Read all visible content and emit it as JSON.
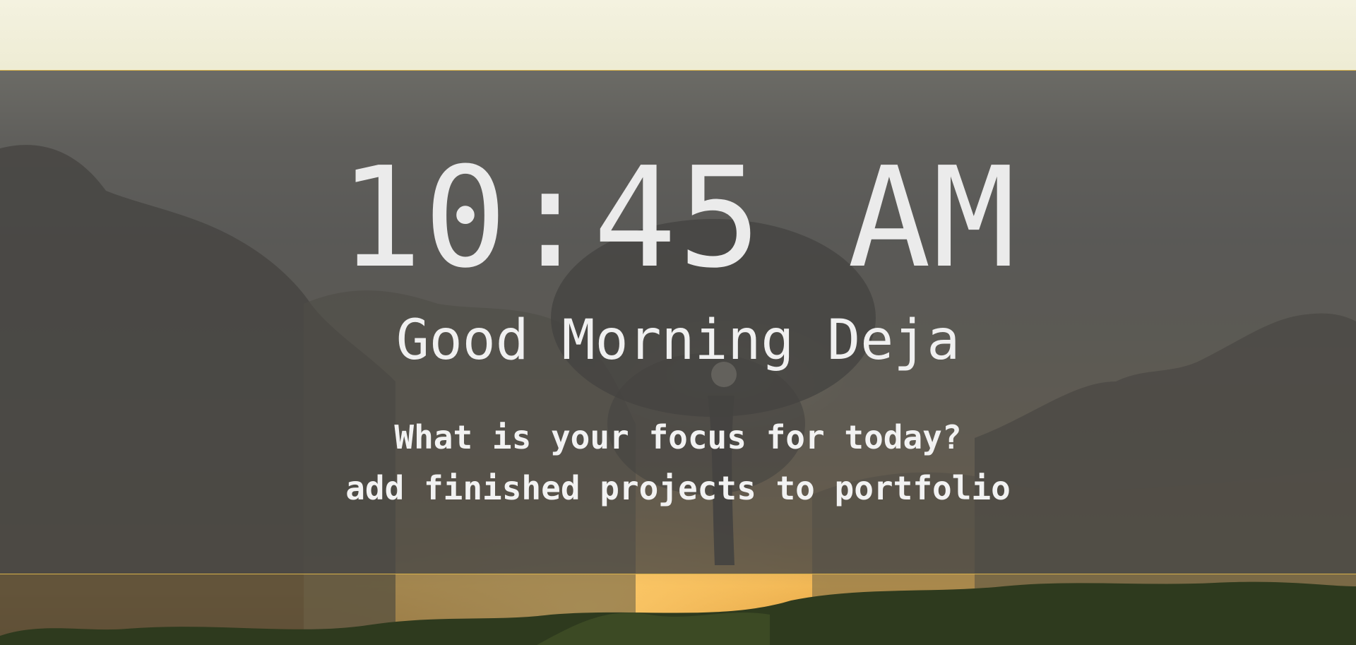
{
  "background": {
    "scene": "misty-landscape-with-tree-at-sunrise",
    "overlay_color": "#464646",
    "accent_border_color": "#d9b24a"
  },
  "clock": {
    "time": "10:45 AM"
  },
  "greeting": {
    "text": "Good Morning Deja"
  },
  "focus": {
    "prompt": "What is your focus for today?",
    "value": "add finished projects to portfolio"
  }
}
